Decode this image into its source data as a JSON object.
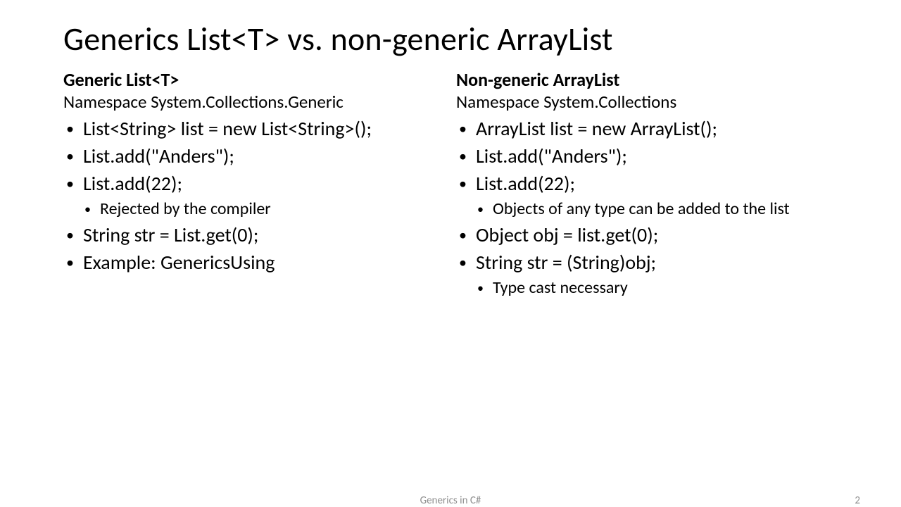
{
  "title": "Generics List<T> vs. non-generic ArrayList",
  "left": {
    "heading": "Generic List<T>",
    "namespace": "Namespace System.Collections.Generic",
    "items": [
      "List<String> list = new List<String>();",
      "List.add(\"Anders\");",
      "List.add(22);",
      "String str = List.get(0);",
      "Example: GenericsUsing"
    ],
    "sub_after_2": "Rejected by the compiler"
  },
  "right": {
    "heading": "Non-generic ArrayList",
    "namespace": "Namespace System.Collections",
    "items": [
      "ArrayList list = new ArrayList();",
      "List.add(\"Anders\");",
      "List.add(22);",
      "Object obj = list.get(0);",
      "String str = (String)obj;"
    ],
    "sub_after_2": "Objects of any type can be added to the list",
    "sub_after_4": "Type cast necessary"
  },
  "footer": {
    "title": "Generics in C#",
    "page": "2"
  }
}
